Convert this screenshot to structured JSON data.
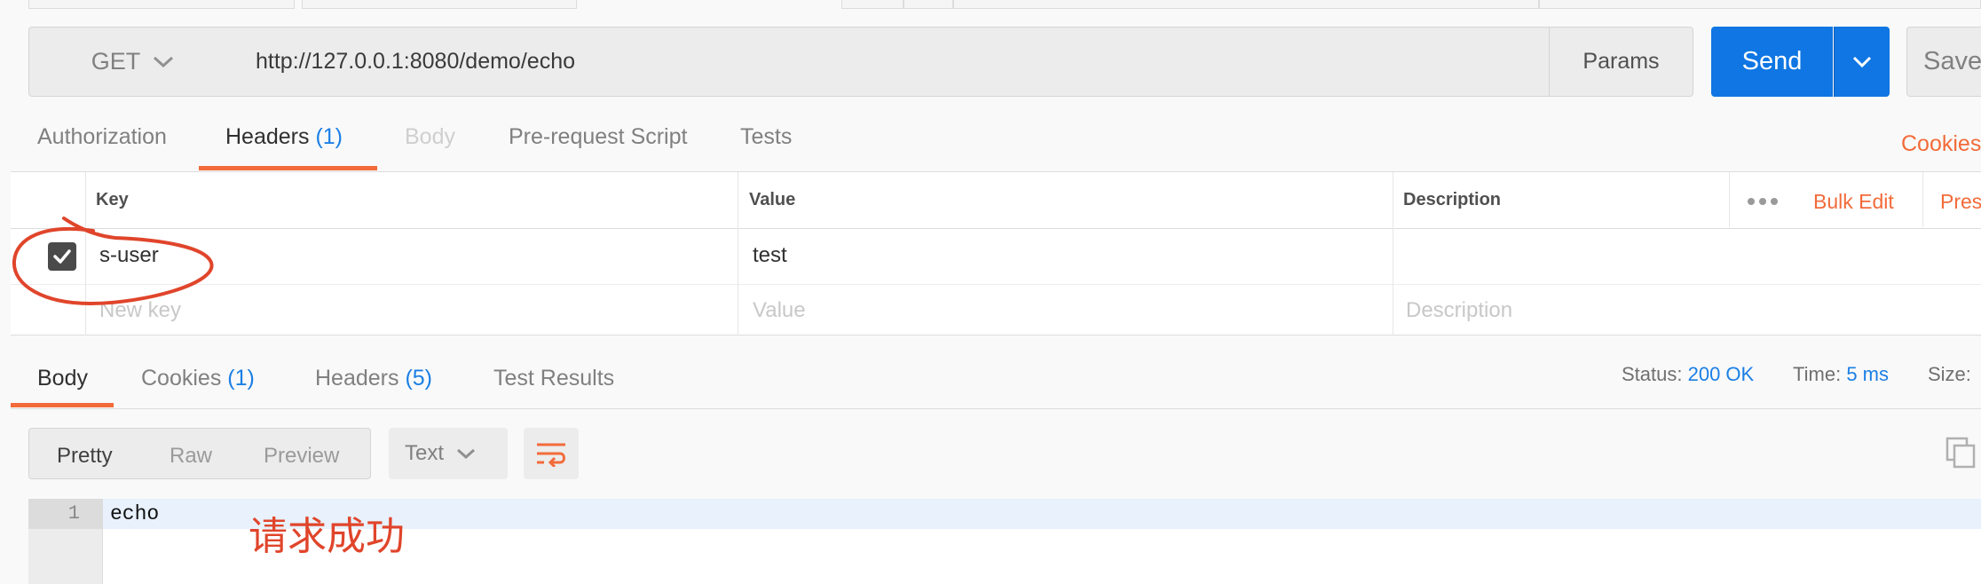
{
  "request": {
    "method": "GET",
    "url": "http://127.0.0.1:8080/demo/echo",
    "params_label": "Params",
    "send_label": "Send",
    "save_label": "Save"
  },
  "request_tabs": [
    {
      "label": "Authorization"
    },
    {
      "label": "Headers",
      "count": "(1)"
    },
    {
      "label": "Body"
    },
    {
      "label": "Pre-request Script"
    },
    {
      "label": "Tests"
    }
  ],
  "cookies_link": "Cookies",
  "headers_table": {
    "columns": {
      "key": "Key",
      "value": "Value",
      "description": "Description"
    },
    "bulk_edit": "Bulk Edit",
    "presets": "Pres",
    "rows": [
      {
        "checked": true,
        "key": "s-user",
        "value": "test",
        "description": ""
      }
    ],
    "placeholder": {
      "key": "New key",
      "value": "Value",
      "description": "Description"
    }
  },
  "response_tabs": [
    {
      "label": "Body"
    },
    {
      "label": "Cookies",
      "count": "(1)"
    },
    {
      "label": "Headers",
      "count": "(5)"
    },
    {
      "label": "Test Results"
    }
  ],
  "response_meta": {
    "status_label": "Status:",
    "status_value": "200 OK",
    "time_label": "Time:",
    "time_value": "5 ms",
    "size_label": "Size:"
  },
  "view_modes": [
    "Pretty",
    "Raw",
    "Preview"
  ],
  "format_select": "Text",
  "body_lines": [
    {
      "num": "1",
      "text": "echo"
    }
  ],
  "annotation_text": "请求成功",
  "colors": {
    "accent": "#f26b3a",
    "send_blue": "#0f76e3",
    "link_blue": "#1b7fe5",
    "annotation_red": "#e0452b"
  },
  "icons": [
    "chevron-down-icon",
    "checkbox-checked-icon",
    "more-dots-icon",
    "wrap-lines-icon",
    "copy-icon"
  ]
}
